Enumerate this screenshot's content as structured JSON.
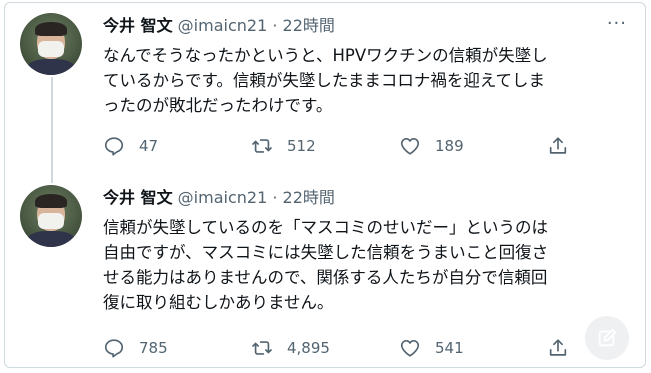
{
  "tweets": [
    {
      "author_name": "今井 智文",
      "handle": "@imaicn21",
      "separator": "·",
      "time": "22時間",
      "text_lines": [
        "なんでそうなったかというと、HPVワクチンの信頼が失墜し",
        "ているからです。信頼が失墜したままコロナ禍を迎えてしま",
        "ったのが敗北だったわけです。"
      ],
      "replies": "47",
      "retweets": "512",
      "likes": "189"
    },
    {
      "author_name": "今井 智文",
      "handle": "@imaicn21",
      "separator": "·",
      "time": "22時間",
      "text_lines": [
        "信頼が失墜しているのを「マスコミのせいだー」というのは",
        "自由ですが、マスコミには失墜した信頼をうまいこと回復さ",
        "せる能力はありませんので、関係する人たちが自分で信頼回",
        "復に取り組むしかありません。"
      ],
      "replies": "785",
      "retweets": "4,895",
      "likes": "541"
    }
  ],
  "more_menu_glyph": "···",
  "icons": {
    "reply": "reply-icon",
    "retweet": "retweet-icon",
    "like": "heart-icon",
    "share": "share-icon",
    "compose": "compose-icon",
    "more": "more-icon"
  },
  "colors": {
    "text": "#0f1419",
    "secondary": "#536471",
    "border": "#cfd9de"
  }
}
